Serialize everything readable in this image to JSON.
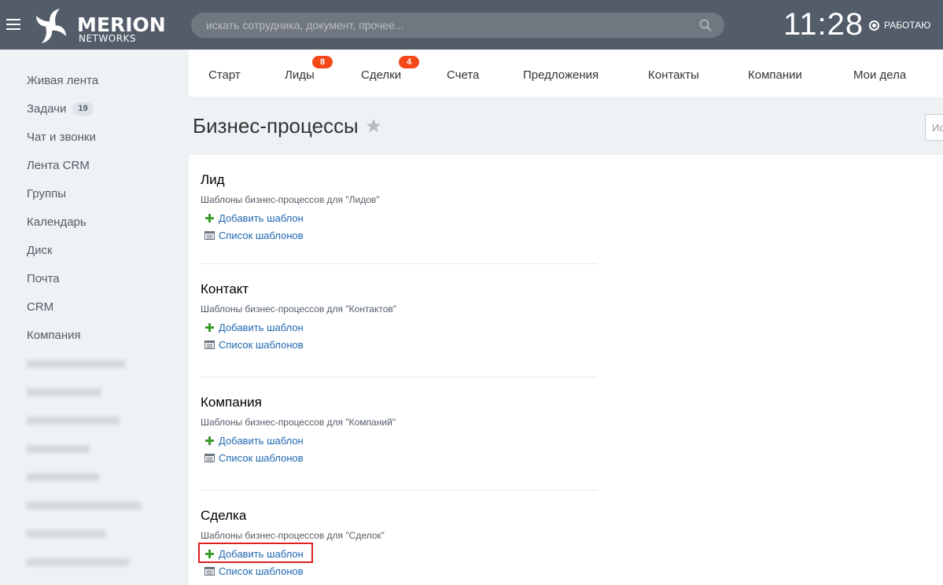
{
  "header": {
    "logo_text": "MERION",
    "logo_sub": "NETWORKS",
    "search_placeholder": "искать сотрудника, документ, прочее...",
    "clock": "11:28",
    "status_label": "РАБОТАЮ"
  },
  "sidebar": {
    "items": [
      {
        "label": "Живая лента"
      },
      {
        "label": "Задачи",
        "badge": "19"
      },
      {
        "label": "Чат и звонки"
      },
      {
        "label": "Лента CRM"
      },
      {
        "label": "Группы"
      },
      {
        "label": "Календарь"
      },
      {
        "label": "Диск"
      },
      {
        "label": "Почта"
      },
      {
        "label": "CRM"
      },
      {
        "label": "Компания"
      }
    ]
  },
  "topnav": {
    "items": [
      {
        "label": "Старт"
      },
      {
        "label": "Лиды",
        "counter": "8"
      },
      {
        "label": "Сделки",
        "counter": "4"
      },
      {
        "label": "Счета"
      },
      {
        "label": "Предложения"
      },
      {
        "label": "Контакты"
      },
      {
        "label": "Компании"
      },
      {
        "label": "Мои дела"
      }
    ]
  },
  "page": {
    "title": "Бизнес-процессы",
    "search_placeholder": "Ис"
  },
  "sections": [
    {
      "title": "Лид",
      "description": "Шаблоны бизнес-процессов для \"Лидов\"",
      "add_label": "Добавить шаблон",
      "list_label": "Список шаблонов"
    },
    {
      "title": "Контакт",
      "description": "Шаблоны бизнес-процессов для \"Контактов\"",
      "add_label": "Добавить шаблон",
      "list_label": "Список шаблонов"
    },
    {
      "title": "Компания",
      "description": "Шаблоны бизнес-процессов для \"Компаний\"",
      "add_label": "Добавить шаблон",
      "list_label": "Список шаблонов"
    },
    {
      "title": "Сделка",
      "description": "Шаблоны бизнес-процессов для \"Сделок\"",
      "add_label": "Добавить шаблон",
      "list_label": "Список шаблонов"
    }
  ],
  "colors": {
    "header_bg": "#535c69",
    "link": "#2067b0",
    "counter": "#f54819",
    "add_icon": "#3c9a2c",
    "highlight": "#e02020"
  }
}
